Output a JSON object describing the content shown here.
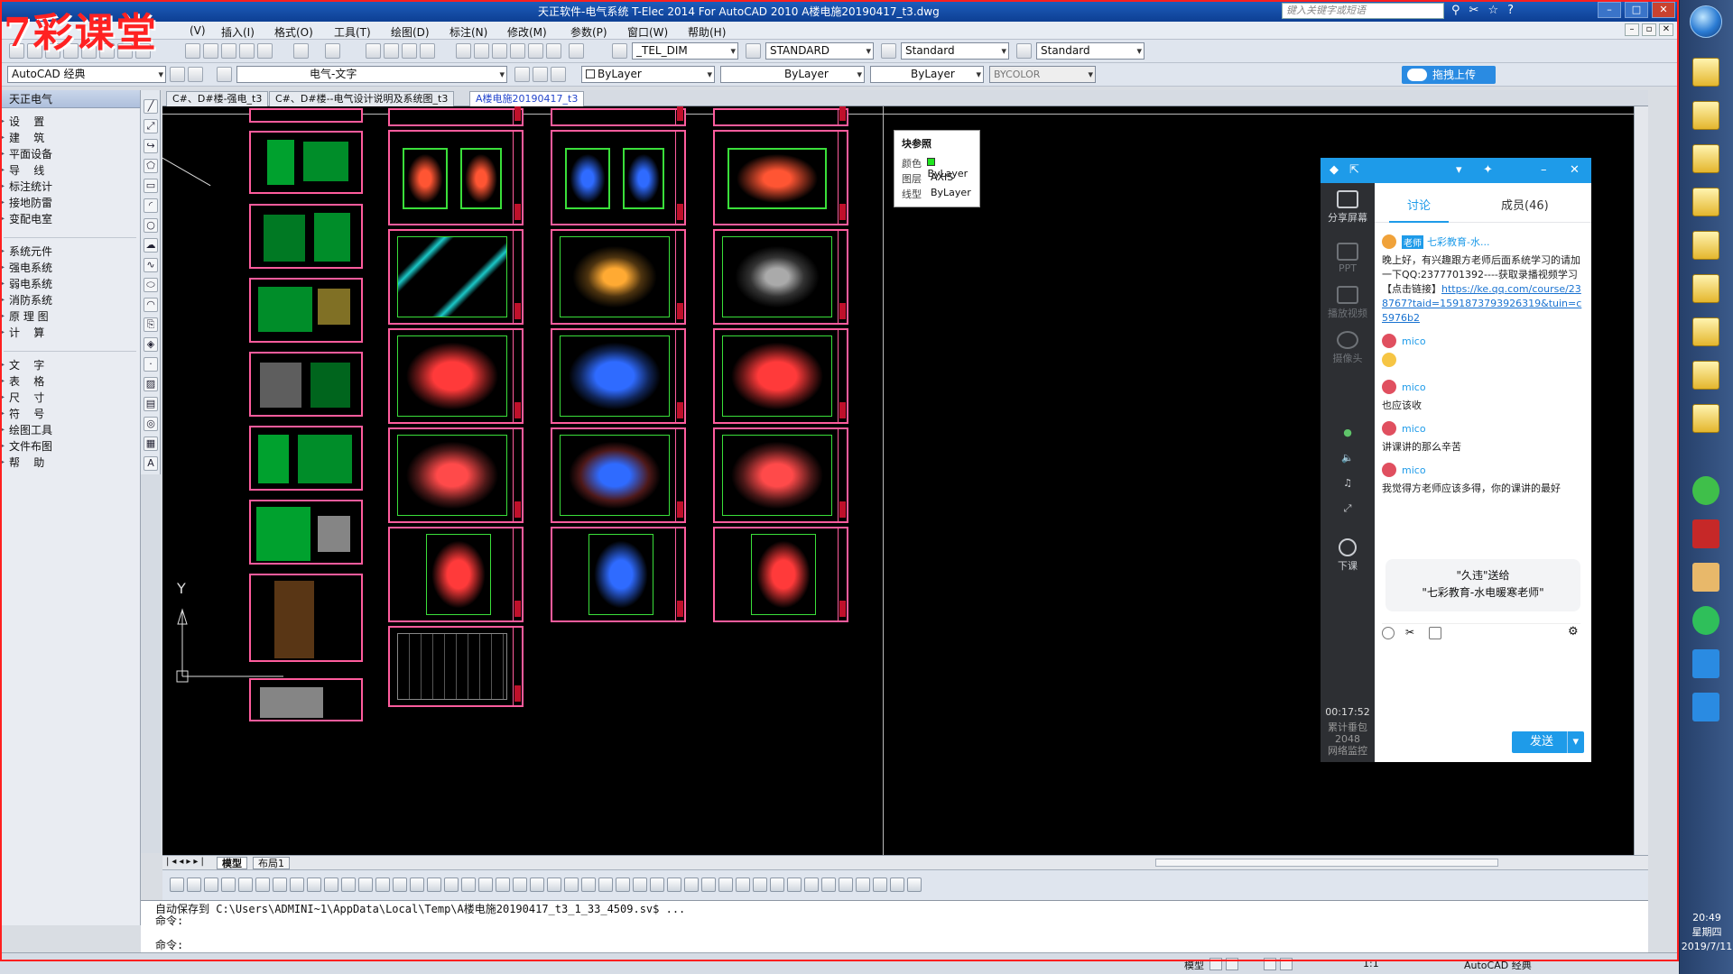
{
  "window": {
    "title": "天正软件-电气系统 T-Elec 2014  For AutoCAD 2010      A楼电施20190417_t3.dwg",
    "search_placeholder": "键入关键字或短语",
    "brand_watermark": "7彩课堂"
  },
  "menu": [
    "(V)",
    "插入(I)",
    "格式(O)",
    "工具(T)",
    "绘图(D)",
    "标注(N)",
    "修改(M)",
    "参数(P)",
    "窗口(W)",
    "帮助(H)"
  ],
  "toolbar1": {
    "text_style": "_TEL_DIM",
    "dim_style": "STANDARD",
    "table_style": "Standard",
    "mleader_style": "Standard"
  },
  "toolbar2": {
    "workspace": "AutoCAD 经典",
    "layer": "电气-文字",
    "color": "ByLayer",
    "linetype": "ByLayer",
    "lineweight": "ByLayer",
    "plotstyle": "BYCOLOR",
    "upload_label": "拖拽上传"
  },
  "palette": {
    "title": "天正电气",
    "groups": [
      [
        "设    置",
        "建    筑",
        "平面设备",
        "导    线",
        "标注统计",
        "接地防雷",
        "变配电室"
      ],
      [
        "系统元件",
        "强电系统",
        "弱电系统",
        "消防系统",
        "原 理 图",
        "计    算"
      ],
      [
        "文    字",
        "表    格",
        "尺    寸",
        "符    号",
        "绘图工具",
        "文件布图",
        "帮    助"
      ]
    ]
  },
  "doc_tabs": [
    "C#、D#楼-强电_t3",
    "C#、D#楼--电气设计说明及系统图_t3",
    "A楼电施20190417_t3"
  ],
  "layout_tabs": [
    "模型",
    "布局1"
  ],
  "block_ref": {
    "title": "块参照",
    "rows": [
      {
        "k": "颜色",
        "v": "ByLayer"
      },
      {
        "k": "图层",
        "v": "AXIS"
      },
      {
        "k": "线型",
        "v": "ByLayer"
      }
    ]
  },
  "ucs": {
    "y": "Y"
  },
  "command": {
    "line1": "自动保存到 C:\\Users\\ADMINI~1\\AppData\\Local\\Temp\\A楼电施20190417_t3_1_33_4509.sv$ ...",
    "line2": "命令:",
    "prompt": "命令:"
  },
  "status": {
    "model": "模型",
    "scale": "1:1",
    "workspace": "AutoCAD 经典"
  },
  "qq": {
    "side": {
      "share": "分享屏幕",
      "ppt": "PPT",
      "video": "播放视频",
      "camera": "摄像头",
      "end": "下课"
    },
    "tabs": {
      "discuss": "讨论",
      "members": "成员(46)"
    },
    "teacher": {
      "tag": "老师",
      "name": "七彩教育-水...",
      "text": "晚上好，有兴趣跟方老师后面系统学习的请加一下QQ:2377701392----获取录播视频学习【点击链接】",
      "link": "https://ke.qq.com/course/238767?taid=1591873793926319&tuin=c5976b2"
    },
    "messages": [
      {
        "name": "mico",
        "text": ""
      },
      {
        "name": "mico",
        "text": "也应该收"
      },
      {
        "name": "mico",
        "text": "讲课讲的那么辛苦"
      },
      {
        "name": "mico",
        "text": "我觉得方老师应该多得，你的课讲的最好"
      }
    ],
    "gift": {
      "line1": "\"久违\"送给",
      "line2": "\"七彩教育-水电暖寒老师\""
    },
    "send_label": "发送",
    "timer": "00:17:52",
    "timer_sub": "累计垂包",
    "timer_count": "2048",
    "timer_note": "网络监控"
  },
  "taskbar": {
    "time": "20:49",
    "weekday": "星期四",
    "date": "2019/7/11"
  }
}
